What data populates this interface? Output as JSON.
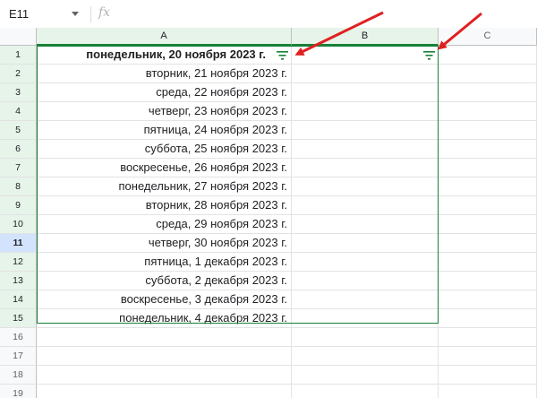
{
  "formula_bar": {
    "name_box": "E11",
    "fx_label": "fx",
    "formula": ""
  },
  "columns": [
    "A",
    "B",
    "C"
  ],
  "rows": [
    {
      "num": "1",
      "a": "понедельник, 20 ноября 2023 г.",
      "b": ""
    },
    {
      "num": "2",
      "a": "вторник, 21 ноября 2023 г.",
      "b": ""
    },
    {
      "num": "3",
      "a": "среда, 22 ноября 2023 г.",
      "b": ""
    },
    {
      "num": "4",
      "a": "четверг, 23 ноября 2023 г.",
      "b": ""
    },
    {
      "num": "5",
      "a": "пятница, 24 ноября 2023 г.",
      "b": ""
    },
    {
      "num": "6",
      "a": "суббота, 25 ноября 2023 г.",
      "b": ""
    },
    {
      "num": "7",
      "a": "воскресенье, 26 ноября 2023 г.",
      "b": ""
    },
    {
      "num": "8",
      "a": "понедельник, 27 ноября 2023 г.",
      "b": ""
    },
    {
      "num": "9",
      "a": "вторник, 28 ноября 2023 г.",
      "b": ""
    },
    {
      "num": "10",
      "a": "среда, 29 ноября 2023 г.",
      "b": ""
    },
    {
      "num": "11",
      "a": "четверг, 30 ноября 2023 г.",
      "b": ""
    },
    {
      "num": "12",
      "a": "пятница, 1 декабря 2023 г.",
      "b": ""
    },
    {
      "num": "13",
      "a": "суббота, 2 декабря 2023 г.",
      "b": ""
    },
    {
      "num": "14",
      "a": "воскресенье, 3 декабря 2023 г.",
      "b": ""
    },
    {
      "num": "15",
      "a": "понедельник, 4 декабря 2023 г.",
      "b": ""
    },
    {
      "num": "16",
      "a": "",
      "b": ""
    },
    {
      "num": "17",
      "a": "",
      "b": ""
    },
    {
      "num": "18",
      "a": "",
      "b": ""
    },
    {
      "num": "19",
      "a": "",
      "b": ""
    }
  ],
  "active_row": "11",
  "colors": {
    "filter_icon": "#188038",
    "range_border": "#188038",
    "annotation_arrow": "#e02020",
    "selected_header": "#e6f4ea"
  },
  "icons": {
    "filter": "filter-icon",
    "dropdown": "chevron-down-icon",
    "function": "fx-icon"
  }
}
